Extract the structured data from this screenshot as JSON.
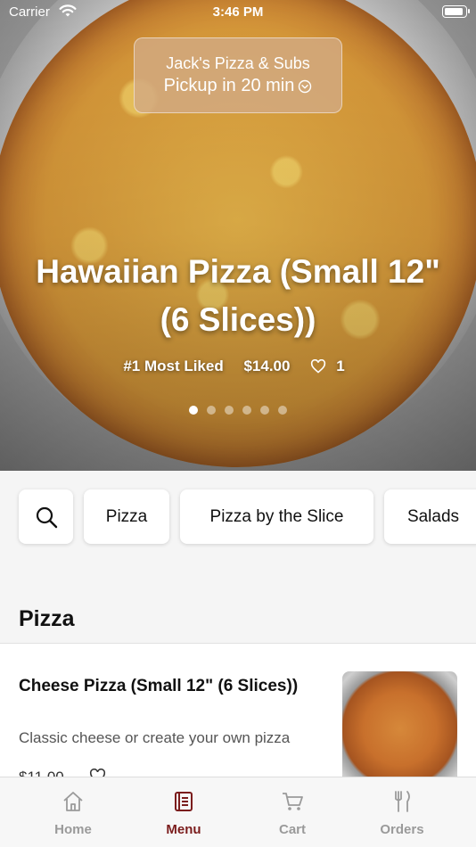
{
  "status_bar": {
    "carrier": "Carrier",
    "time": "3:46 PM"
  },
  "restaurant": {
    "name": "Jack's Pizza & Subs",
    "pickup": "Pickup in 20 min"
  },
  "hero": {
    "title": "Hawaiian Pizza (Small 12\" (6 Slices))",
    "rank": "#1 Most Liked",
    "price": "$14.00",
    "likes": "1",
    "carousel_total": 6,
    "carousel_active": 1
  },
  "categories": [
    "Pizza",
    "Pizza by the Slice",
    "Salads"
  ],
  "section": {
    "title": "Pizza"
  },
  "item": {
    "name": "Cheese Pizza (Small 12\" (6 Slices))",
    "description": "Classic cheese or create your own pizza",
    "price": "$11.00"
  },
  "tabs": [
    {
      "label": "Home",
      "icon": "home-icon"
    },
    {
      "label": "Menu",
      "icon": "menu-book-icon"
    },
    {
      "label": "Cart",
      "icon": "cart-icon"
    },
    {
      "label": "Orders",
      "icon": "fork-knife-icon"
    }
  ],
  "colors": {
    "accent": "#7b1d1d",
    "tab_inactive": "#9a9a9a",
    "pill": "#d2aa82"
  }
}
